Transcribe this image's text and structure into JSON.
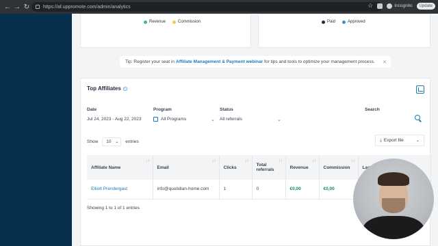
{
  "browser": {
    "url": "https://af.uppromote.com/admin/analytics",
    "incognito_label": "Incognito",
    "update_label": "Update"
  },
  "charts": {
    "left_legend": [
      "Revenue",
      "Commission"
    ],
    "right_legend": [
      "Paid",
      "Approved"
    ],
    "colors": {
      "revenue": "#3cb79a",
      "commission": "#f2c94c",
      "paid": "#1f2d3d",
      "approved": "#3b8fd6"
    }
  },
  "tip": {
    "prefix": "Tip: Register your seat in",
    "link": "Affiliate Management & Payment webinar",
    "suffix": "for tips and tools to optimize your management process."
  },
  "panel": {
    "title": "Top Affiliates",
    "filters": {
      "date_label": "Date",
      "date_value": "Jul 24, 2023 - Aug 22, 2023",
      "program_label": "Program",
      "program_value": "All Programs",
      "status_label": "Status",
      "status_value": "All referrals",
      "search_label": "Search"
    },
    "show_label": "Show",
    "entries_value": "10",
    "entries_label": "entries",
    "export_label": "Export file",
    "columns": [
      "Affiliate Name",
      "Email",
      "Clicks",
      "Total referrals",
      "Revenue",
      "Commission",
      "Last P"
    ],
    "rows": [
      {
        "name": "Elliott Prendergast",
        "email": "info@quotidian-home.com",
        "clicks": "1",
        "referrals": "0",
        "revenue": "€0,00",
        "commission": "€0,00",
        "last": ""
      }
    ],
    "showing_text": "Showing 1 to 1 of 1 entries"
  }
}
